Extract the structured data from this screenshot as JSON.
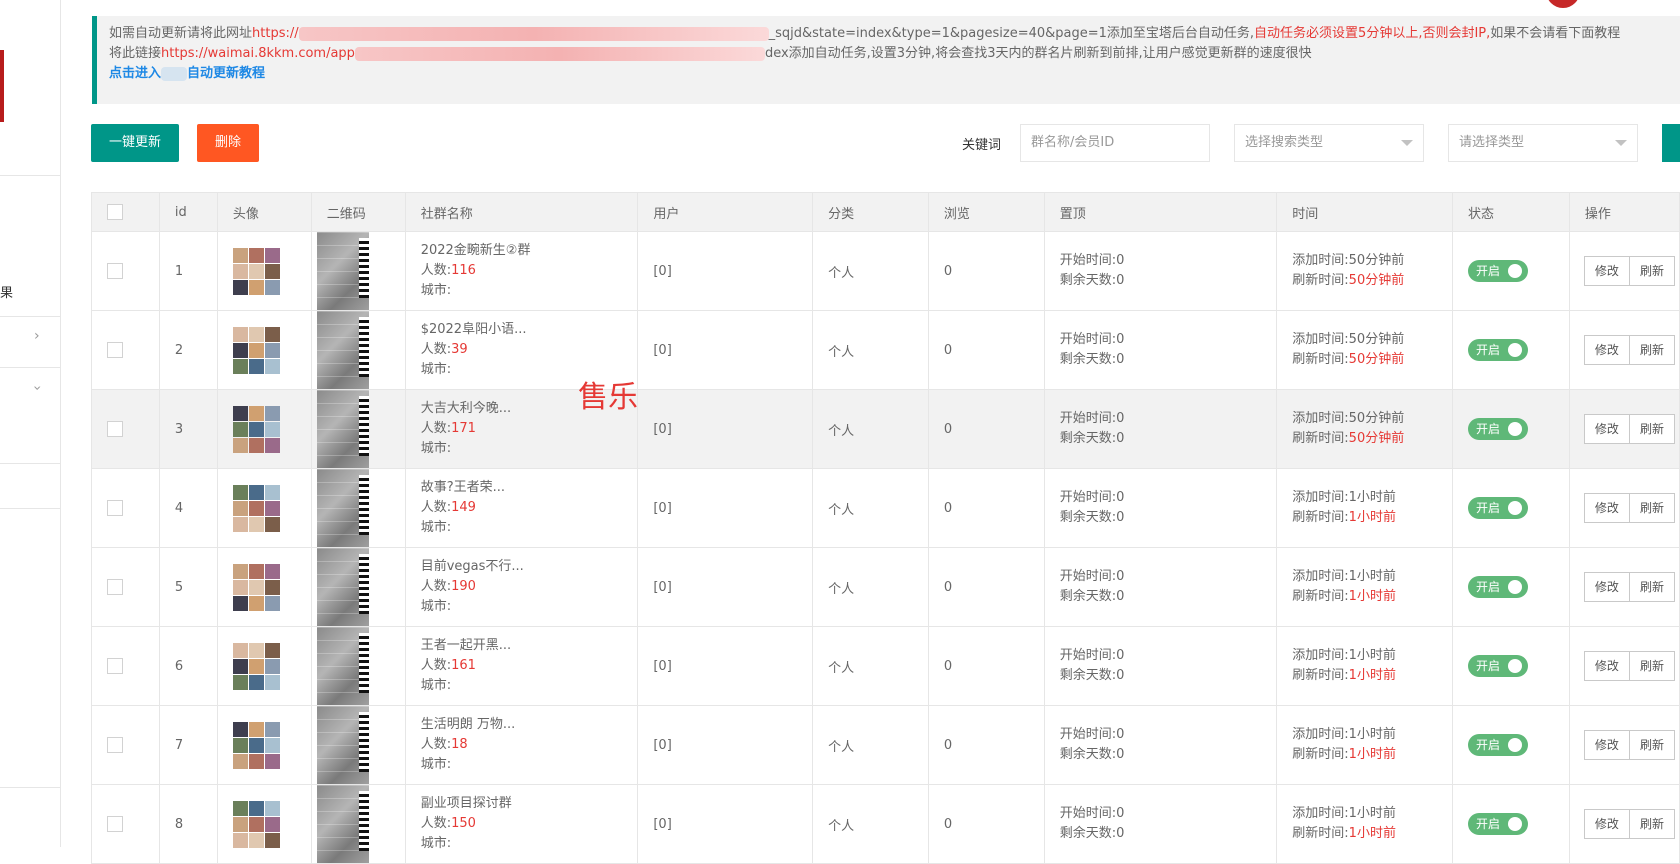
{
  "notice": {
    "line1_prefix": "如需自动更新请将此网址",
    "line1_url_start": "https://",
    "line1_url_end": "_sqjd&state=index&type=1&pagesize=40&page=1",
    "line1_after": "添加至宝塔后台自动任务,",
    "line1_warning": "自动任务必须设置5分钟以上,否则会封IP,",
    "line1_tail": "如果不会请看下面教程",
    "line2_prefix": "将此链接",
    "line2_url": "https://waimai.8kkm.com/app",
    "line2_tail": "dex添加自动任务,设置3分钟,将会查找3天内的群名片刷新到前排,让用户感觉更新群的速度很快",
    "tutorial_link_a": "点击进入",
    "tutorial_link_b": "自动更新教程"
  },
  "toolbar": {
    "update_button": "一键更新",
    "delete_button": "删除",
    "keyword_label": "关键词",
    "search_placeholder": "群名称/会员ID",
    "search_type_select": "选择搜索类型",
    "category_select": "请选择类型"
  },
  "table": {
    "headers": [
      "id",
      "头像",
      "二维码",
      "社群名称",
      "用户",
      "分类",
      "浏览",
      "置顶",
      "时间",
      "状态",
      "操作"
    ],
    "rows": [
      {
        "id": "1",
        "name": "2022金畹新生②群",
        "count": "116",
        "city": "城市:",
        "user": "[0]",
        "category": "个人",
        "views": "0",
        "start": "开始时间:0",
        "remain": "剩余天数:0",
        "added": "添加时间:50分钟前",
        "refresh_label": "刷新时间:",
        "refresh_val": "50分钟前",
        "status": "开启"
      },
      {
        "id": "2",
        "name": "$2022阜阳小语...",
        "count": "39",
        "city": "城市:",
        "user": "[0]",
        "category": "个人",
        "views": "0",
        "start": "开始时间:0",
        "remain": "剩余天数:0",
        "added": "添加时间:50分钟前",
        "refresh_label": "刷新时间:",
        "refresh_val": "50分钟前",
        "status": "开启"
      },
      {
        "id": "3",
        "name": "大吉大利今晚...",
        "count": "171",
        "city": "城市:",
        "user": "[0]",
        "category": "个人",
        "views": "0",
        "start": "开始时间:0",
        "remain": "剩余天数:0",
        "added": "添加时间:50分钟前",
        "refresh_label": "刷新时间:",
        "refresh_val": "50分钟前",
        "status": "开启"
      },
      {
        "id": "4",
        "name": "故事?王者荣...",
        "count": "149",
        "city": "城市:",
        "user": "[0]",
        "category": "个人",
        "views": "0",
        "start": "开始时间:0",
        "remain": "剩余天数:0",
        "added": "添加时间:1小时前",
        "refresh_label": "刷新时间:",
        "refresh_val": "1小时前",
        "status": "开启"
      },
      {
        "id": "5",
        "name": "目前vegas不行...",
        "count": "190",
        "city": "城市:",
        "user": "[0]",
        "category": "个人",
        "views": "0",
        "start": "开始时间:0",
        "remain": "剩余天数:0",
        "added": "添加时间:1小时前",
        "refresh_label": "刷新时间:",
        "refresh_val": "1小时前",
        "status": "开启"
      },
      {
        "id": "6",
        "name": "王者一起开黑...",
        "count": "161",
        "city": "城市:",
        "user": "[0]",
        "category": "个人",
        "views": "0",
        "start": "开始时间:0",
        "remain": "剩余天数:0",
        "added": "添加时间:1小时前",
        "refresh_label": "刷新时间:",
        "refresh_val": "1小时前",
        "status": "开启"
      },
      {
        "id": "7",
        "name": "生活明朗 万物...",
        "count": "18",
        "city": "城市:",
        "user": "[0]",
        "category": "个人",
        "views": "0",
        "start": "开始时间:0",
        "remain": "剩余天数:0",
        "added": "添加时间:1小时前",
        "refresh_label": "刷新时间:",
        "refresh_val": "1小时前",
        "status": "开启"
      },
      {
        "id": "8",
        "name": "副业项目探讨群",
        "count": "150",
        "city": "城市:",
        "user": "[0]",
        "category": "个人",
        "views": "0",
        "start": "开始时间:0",
        "remain": "剩余天数:0",
        "added": "添加时间:1小时前",
        "refresh_label": "刷新时间:",
        "refresh_val": "1小时前",
        "status": "开启"
      }
    ],
    "count_label": "人数:",
    "edit_button": "修改",
    "refresh_button": "刷新"
  },
  "watermark": "售乐",
  "sidebar": {
    "partial_char": "果"
  },
  "colors": {
    "primary": "#009688",
    "danger": "#ff5722",
    "switch_on": "#5fb878",
    "highlight_red": "#e53935"
  }
}
